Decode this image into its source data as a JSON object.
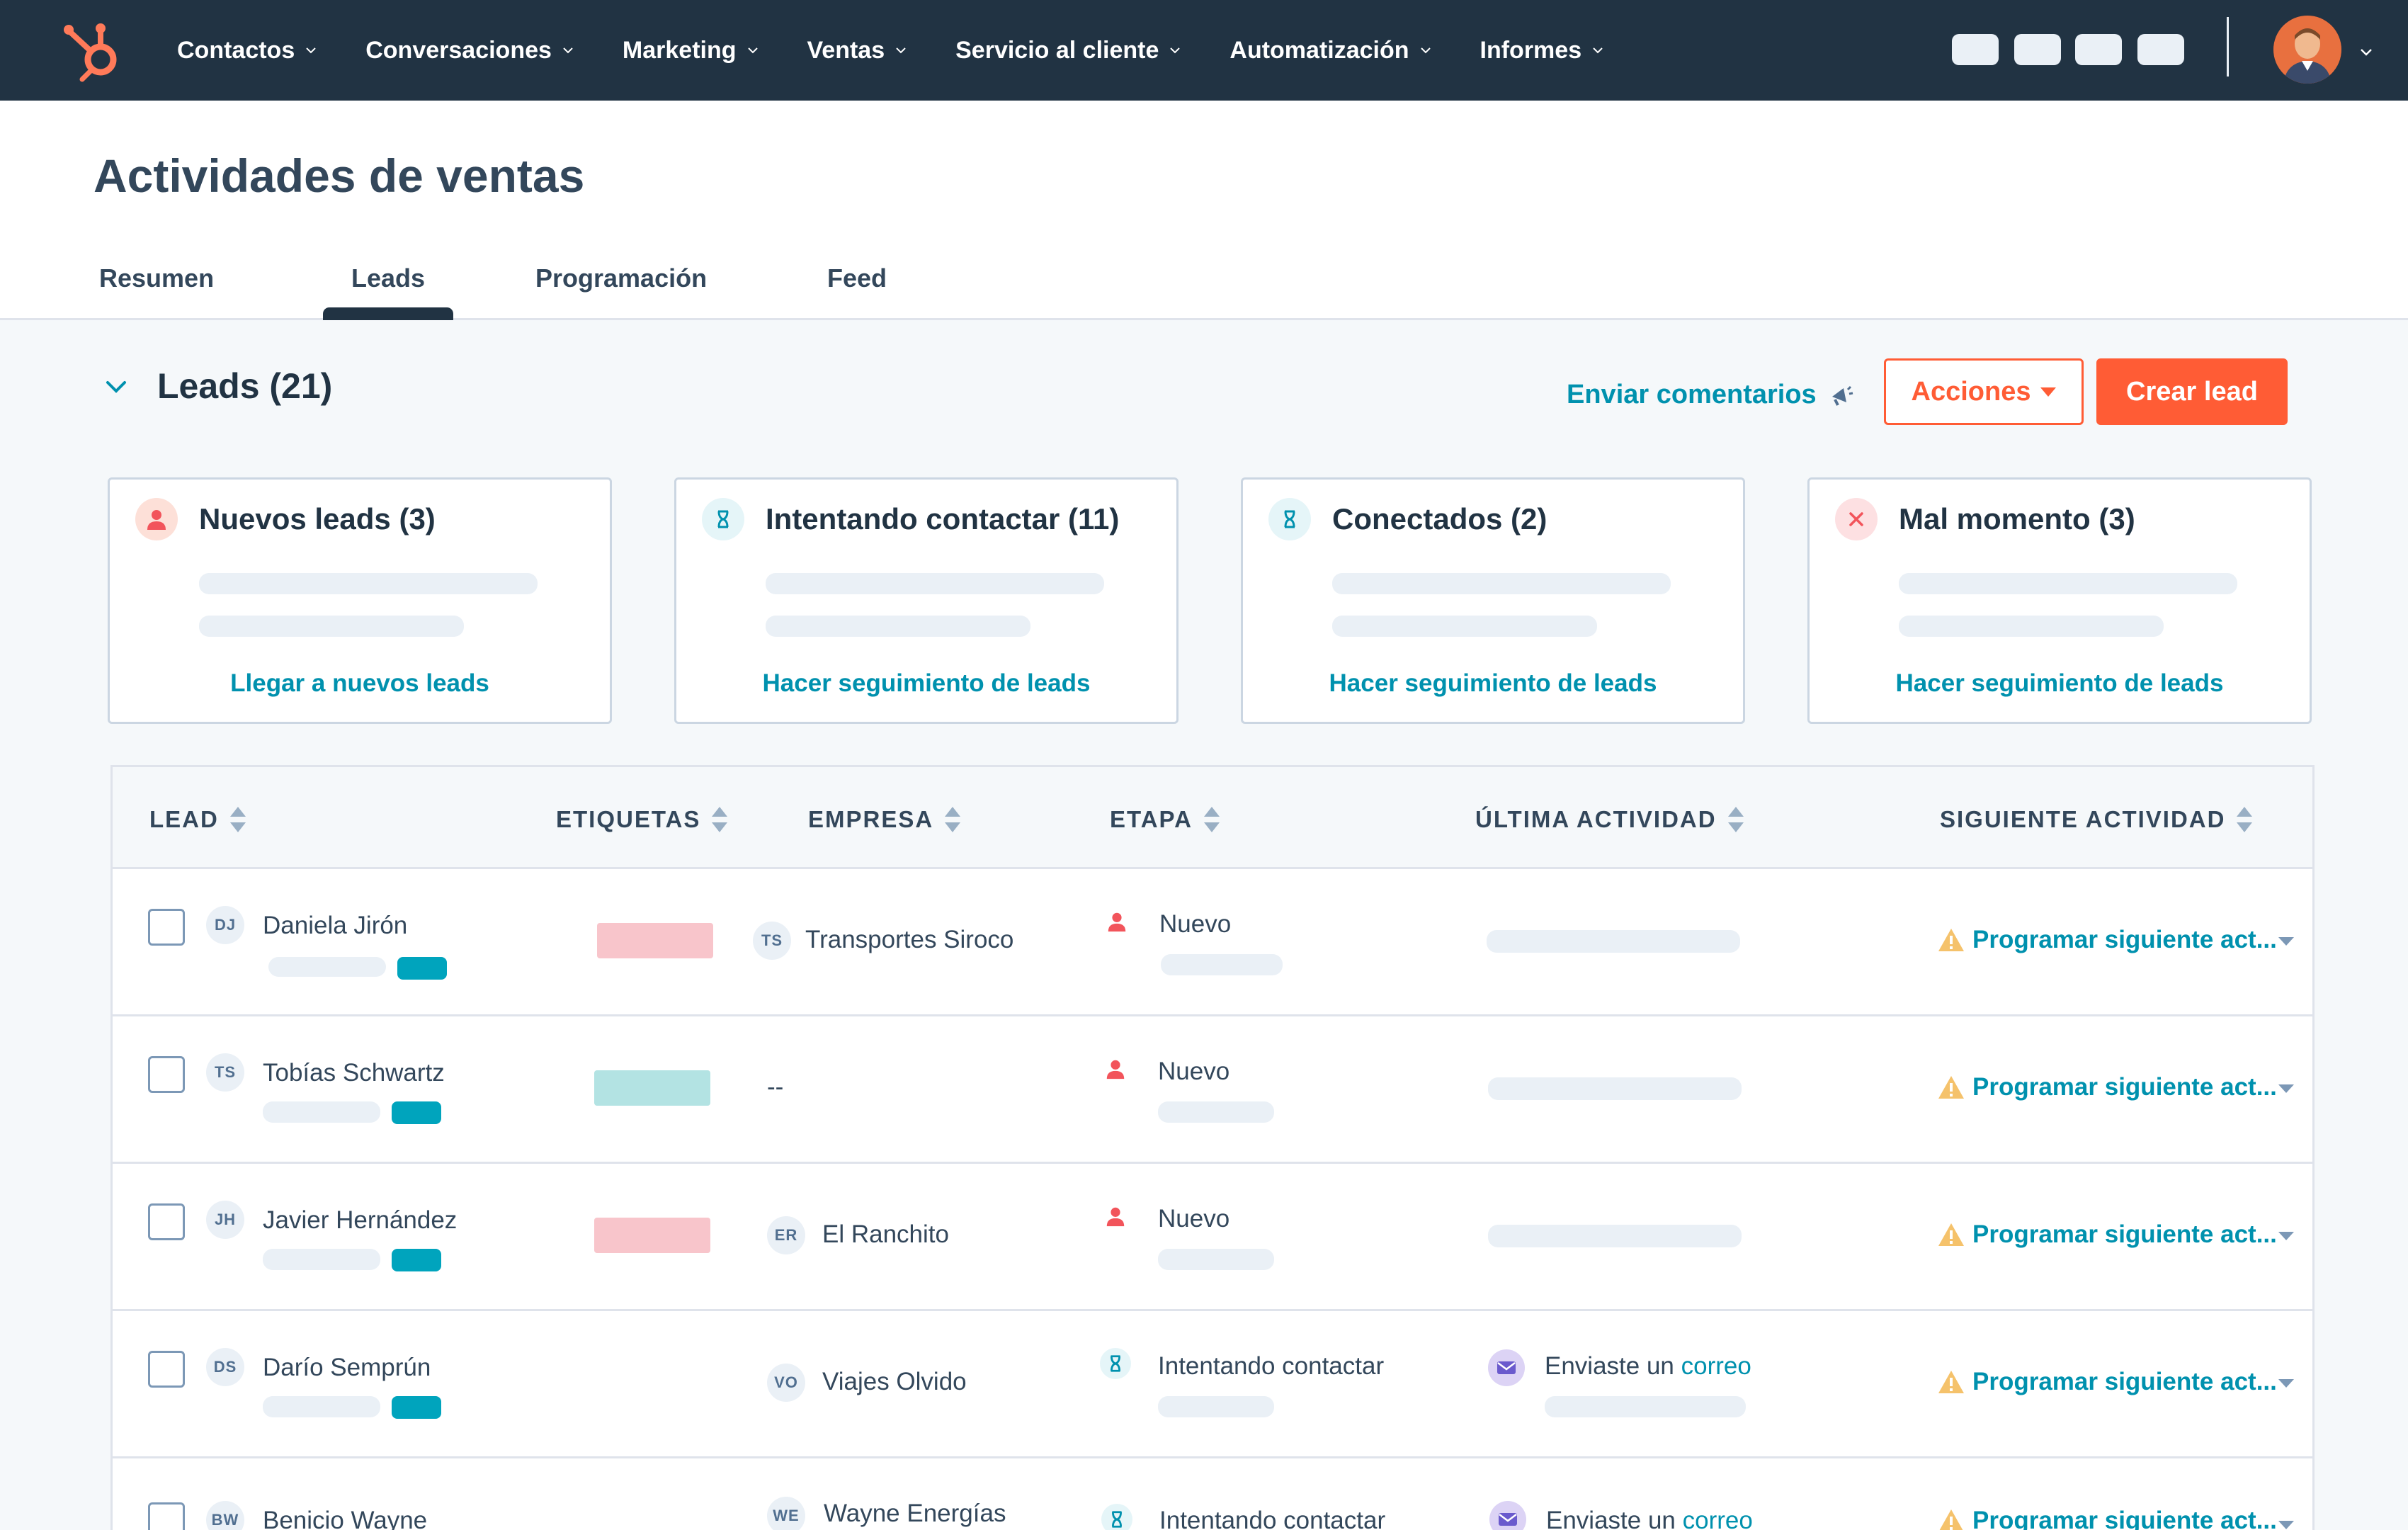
{
  "nav": {
    "items": [
      "Contactos",
      "Conversaciones",
      "Marketing",
      "Ventas",
      "Servicio al cliente",
      "Automatización",
      "Informes"
    ]
  },
  "header": {
    "title": "Actividades de ventas",
    "tabs": [
      "Resumen",
      "Leads",
      "Programación",
      "Feed"
    ],
    "active_tab": "Leads"
  },
  "section": {
    "title": "Leads (21)",
    "feedback": "Enviar comentarios",
    "actions_label": "Acciones",
    "create_label": "Crear lead"
  },
  "cards": [
    {
      "title": "Nuevos leads (3)",
      "link": "Llegar a nuevos leads",
      "icon": "person-icon"
    },
    {
      "title": "Intentando contactar (11)",
      "link": "Hacer seguimiento de leads",
      "icon": "hourglass-icon"
    },
    {
      "title": "Conectados (2)",
      "link": "Hacer seguimiento de leads",
      "icon": "hourglass-icon"
    },
    {
      "title": "Mal momento (3)",
      "link": "Hacer seguimiento de leads",
      "icon": "close-icon"
    }
  ],
  "table": {
    "columns": [
      "LEAD",
      "ETIQUETAS",
      "EMPRESA",
      "ETAPA",
      "ÚLTIMA ACTIVIDAD",
      "SIGUIENTE ACTIVIDAD"
    ],
    "rows": [
      {
        "initials": "DJ",
        "name": "Daniela Jirón",
        "tag_color": "#f8c5cb",
        "company_initials": "TS",
        "company": "Transportes Siroco",
        "stage": "Nuevo",
        "last_activity": "",
        "last_activity_link": "",
        "next": "Programar siguiente act..."
      },
      {
        "initials": "TS",
        "name": "Tobías Schwartz",
        "tag_color": "#b3e3e3",
        "company_initials": "",
        "company": "--",
        "stage": "Nuevo",
        "last_activity": "",
        "last_activity_link": "",
        "next": "Programar siguiente act..."
      },
      {
        "initials": "JH",
        "name": "Javier Hernández",
        "tag_color": "#f8c5cb",
        "company_initials": "ER",
        "company": "El Ranchito",
        "stage": "Nuevo",
        "last_activity": "",
        "last_activity_link": "",
        "next": "Programar siguiente act..."
      },
      {
        "initials": "DS",
        "name": "Darío Semprún",
        "tag_color": "",
        "company_initials": "VO",
        "company": "Viajes Olvido",
        "stage": "Intentando contactar",
        "last_activity": "Enviaste un",
        "last_activity_link": "correo",
        "next": "Programar siguiente act..."
      },
      {
        "initials": "BW",
        "name": "Benicio Wayne",
        "tag_color": "",
        "company_initials": "WE",
        "company": "Wayne Energías",
        "stage": "Intentando contactar",
        "last_activity": "Enviaste un",
        "last_activity_link": "correo",
        "next": "Programar siguiente act..."
      }
    ]
  },
  "colors": {
    "brand": "#ff5c35",
    "navbar": "#213343",
    "link": "#0091ae"
  }
}
